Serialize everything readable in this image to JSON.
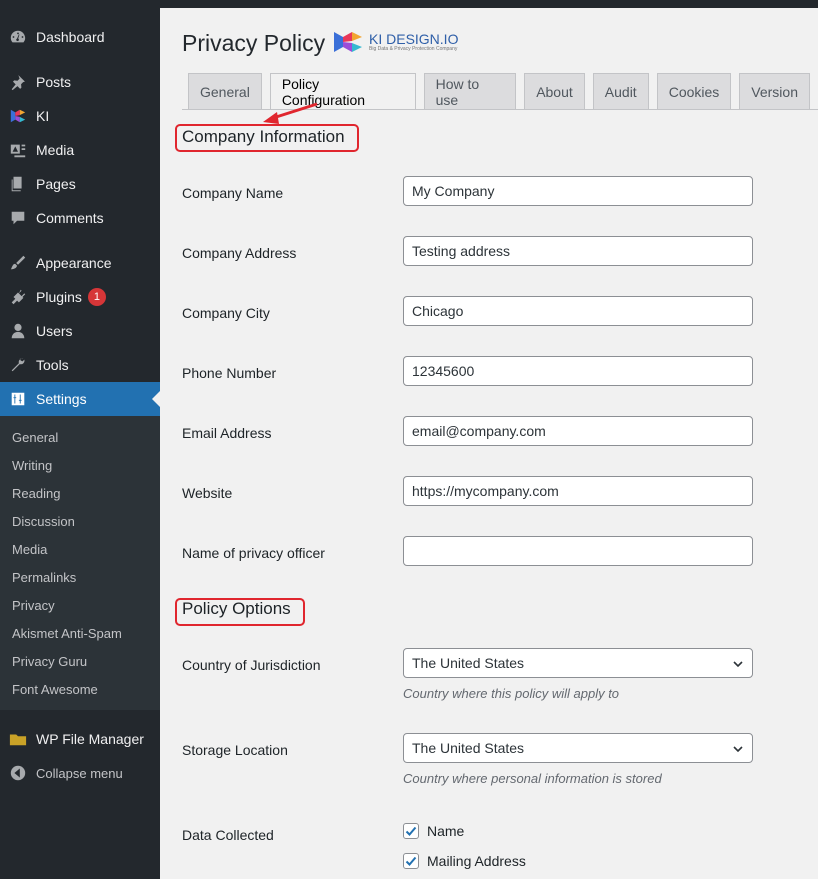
{
  "sidebar": {
    "items": [
      {
        "label": "Dashboard",
        "icon": "dashboard-icon"
      },
      {
        "label": "Posts",
        "icon": "pin-icon"
      },
      {
        "label": "KI",
        "icon": "ki-logo-icon"
      },
      {
        "label": "Media",
        "icon": "media-icon"
      },
      {
        "label": "Pages",
        "icon": "pages-icon"
      },
      {
        "label": "Comments",
        "icon": "comment-icon"
      },
      {
        "label": "Appearance",
        "icon": "brush-icon"
      },
      {
        "label": "Plugins",
        "icon": "plugin-icon",
        "badge": "1"
      },
      {
        "label": "Users",
        "icon": "user-icon"
      },
      {
        "label": "Tools",
        "icon": "wrench-icon"
      },
      {
        "label": "Settings",
        "icon": "settings-icon",
        "active": true
      }
    ],
    "submenu": [
      "General",
      "Writing",
      "Reading",
      "Discussion",
      "Media",
      "Permalinks",
      "Privacy",
      "Akismet Anti-Spam",
      "Privacy Guru",
      "Font Awesome"
    ],
    "file_manager": "WP File Manager",
    "collapse": "Collapse menu"
  },
  "header": {
    "title": "Privacy Policy",
    "logo_text": "KI DESIGN.IO",
    "logo_sub": "Big Data & Privacy Protection Company"
  },
  "tabs": [
    "General",
    "Policy Configuration",
    "How to use",
    "About",
    "Audit",
    "Cookies",
    "Version"
  ],
  "active_tab": "Policy Configuration",
  "company_section": {
    "title": "Company Information",
    "fields": [
      {
        "label": "Company Name",
        "value": "My Company"
      },
      {
        "label": "Company Address",
        "value": "Testing address"
      },
      {
        "label": "Company City",
        "value": "Chicago"
      },
      {
        "label": "Phone Number",
        "value": "12345600"
      },
      {
        "label": "Email Address",
        "value": "email@company.com"
      },
      {
        "label": "Website",
        "value": "https://mycompany.com"
      },
      {
        "label": "Name of privacy officer",
        "value": ""
      }
    ]
  },
  "policy_section": {
    "title": "Policy Options",
    "jurisdiction": {
      "label": "Country of Jurisdiction",
      "value": "The United States",
      "description": "Country where this policy will apply to"
    },
    "storage": {
      "label": "Storage Location",
      "value": "The United States",
      "description": "Country where personal information is stored"
    },
    "data_collected": {
      "label": "Data Collected",
      "options": [
        {
          "label": "Name",
          "checked": true
        },
        {
          "label": "Mailing Address",
          "checked": true
        }
      ]
    }
  },
  "colors": {
    "accent": "#2271b1",
    "highlight": "#e0262e",
    "sidebar": "#23282d"
  }
}
